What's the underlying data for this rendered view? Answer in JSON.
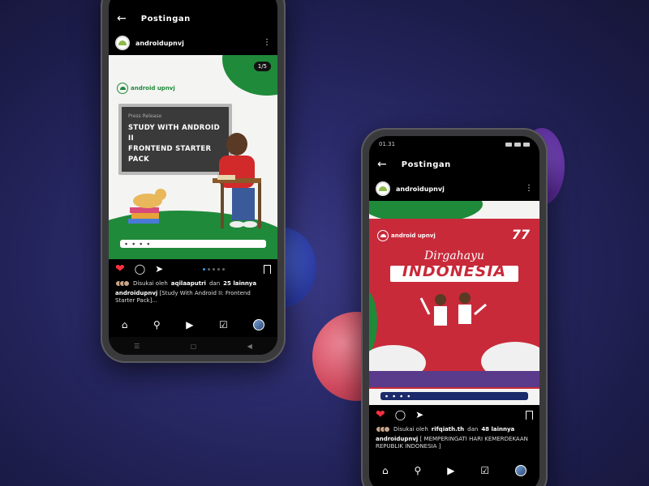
{
  "phones": {
    "left": {
      "status_time": "",
      "header": {
        "title": "Postingan"
      },
      "post": {
        "username": "androidupnvj",
        "page_counter": "1/5",
        "brand": "android upnvj",
        "press_label": "Press Release",
        "board_title_lines": [
          "STUDY WITH ANDROID II",
          "FRONTEND STARTER",
          "PACK"
        ],
        "likes_prefix": "Disukai oleh",
        "likes_user": "aqilaaputri",
        "likes_mid": "dan",
        "likes_count": "25 lainnya",
        "caption_user": "androidupnvj",
        "caption_text": "[Study With Android II: Frontend Starter Pack]..."
      }
    },
    "right": {
      "status_time": "01.31",
      "header": {
        "title": "Postingan"
      },
      "post": {
        "username": "androidupnvj",
        "brand": "android upnvj",
        "badge": "77",
        "greeting": "Dirgahayu",
        "headline": "INDONESIA",
        "likes_prefix": "Disukai oleh",
        "likes_user": "rifqiath.th",
        "likes_mid": "dan",
        "likes_count": "48 lainnya",
        "caption_user": "androidupnvj",
        "caption_text": "[ MEMPERINGATI HARI KEMERDEKAAN REPUBLIK INDONESIA ]"
      }
    }
  },
  "icons": {
    "back": "arrow-left-icon",
    "more": "more-vertical-icon",
    "like": "heart-icon",
    "comment": "comment-icon",
    "share": "send-icon",
    "save": "bookmark-icon",
    "home": "home-icon",
    "search": "search-icon",
    "reels": "reels-icon",
    "shop": "shop-icon",
    "profile": "profile-avatar-icon"
  },
  "colors": {
    "accent_like": "#ff3040",
    "brand_green": "#1f8a3a",
    "indonesia_red": "#c82a3a",
    "background": "#2a2a6a"
  }
}
